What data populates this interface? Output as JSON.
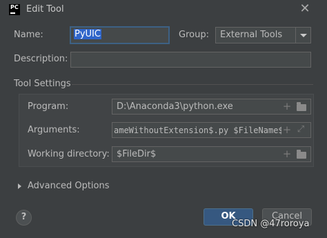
{
  "window": {
    "title": "Edit Tool",
    "app_logo": "PC"
  },
  "form": {
    "name_label": "Name:",
    "name_value": "PyUIC",
    "group_label": "Group:",
    "group_value": "External Tools",
    "description_label": "Description:",
    "description_value": ""
  },
  "tool_settings": {
    "section_label": "Tool Settings",
    "program_label": "Program:",
    "program_value": "D:\\Anaconda3\\python.exe",
    "arguments_label": "Arguments:",
    "arguments_value": "ameWithoutExtension$.py $FileName$",
    "working_dir_label": "Working directory:",
    "working_dir_value": "$FileDir$"
  },
  "advanced": {
    "label": "Advanced Options"
  },
  "buttons": {
    "help": "?",
    "ok": "OK",
    "cancel": "Cancel"
  },
  "watermark": "CSDN @47roroya",
  "icons": [
    "pc-logo-icon",
    "close-icon",
    "chevron-down-icon",
    "plus-icon",
    "folder-icon",
    "expand-icon",
    "triangle-right-icon",
    "help-icon"
  ]
}
